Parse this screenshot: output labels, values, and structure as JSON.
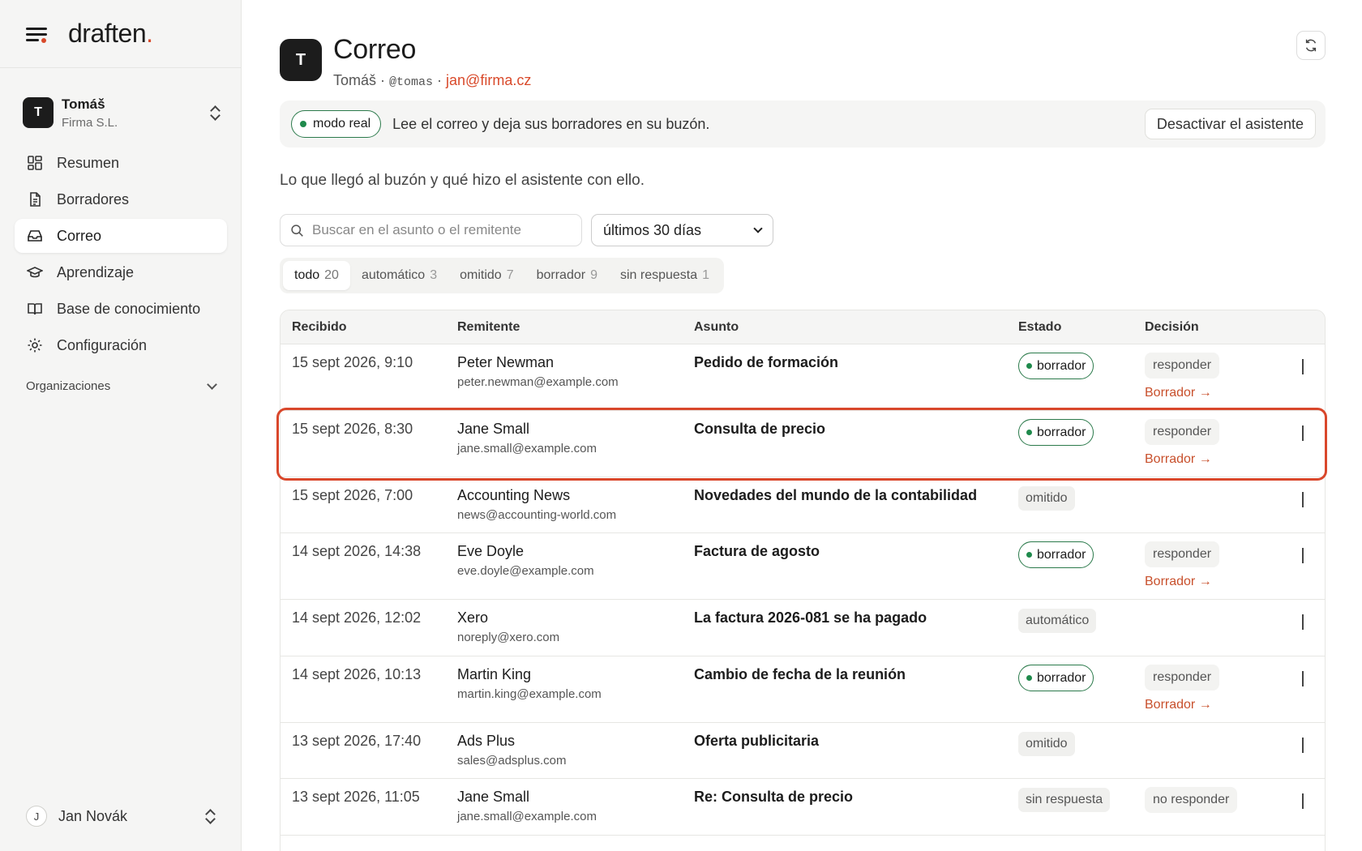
{
  "brand": {
    "name": "draften",
    "dot": "."
  },
  "org": {
    "initial": "T",
    "name": "Tomáš",
    "company": "Firma S.L."
  },
  "nav": {
    "items": [
      {
        "label": "Resumen",
        "icon": "dashboard-icon"
      },
      {
        "label": "Borradores",
        "icon": "document-icon"
      },
      {
        "label": "Correo",
        "icon": "inbox-icon",
        "active": true
      },
      {
        "label": "Aprendizaje",
        "icon": "graduation-cap-icon"
      },
      {
        "label": "Base de conocimiento",
        "icon": "book-icon"
      },
      {
        "label": "Configuración",
        "icon": "gear-icon"
      }
    ],
    "section_label": "Organizaciones"
  },
  "user": {
    "initial": "J",
    "name": "Jan Novák"
  },
  "header": {
    "initial": "T",
    "title": "Correo",
    "owner": "Tomáš",
    "sep1": " · ",
    "handle": "@tomas",
    "sep2": " · ",
    "email": "jan@firma.cz"
  },
  "banner": {
    "mode": "modo real",
    "text": "Lee el correo y deja sus borradores en su buzón.",
    "button": "Desactivar el asistente"
  },
  "intro": "Lo que llegó al buzón y qué hizo el asistente con ello.",
  "search": {
    "placeholder": "Buscar en el asunto o el remitente"
  },
  "period": {
    "selected": "últimos 30 días"
  },
  "filters": [
    {
      "label": "todo",
      "count": "20",
      "active": true
    },
    {
      "label": "automático",
      "count": "3"
    },
    {
      "label": "omitido",
      "count": "7"
    },
    {
      "label": "borrador",
      "count": "9"
    },
    {
      "label": "sin respuesta",
      "count": "1"
    }
  ],
  "table": {
    "headers": {
      "received": "Recibido",
      "sender": "Remitente",
      "subject": "Asunto",
      "status": "Estado",
      "decision": "Decisión"
    },
    "rows": [
      {
        "received": "15 sept 2026, 9:10",
        "sender": "Peter Newman",
        "email": "peter.newman@example.com",
        "subject": "Pedido de formación",
        "status": "borrador",
        "decision": "responder",
        "link": "Borrador →"
      },
      {
        "received": "15 sept 2026, 8:30",
        "sender": "Jane Small",
        "email": "jane.small@example.com",
        "subject": "Consulta de precio",
        "status": "borrador",
        "decision": "responder",
        "link": "Borrador →"
      },
      {
        "received": "15 sept 2026, 7:00",
        "sender": "Accounting News",
        "email": "news@accounting-world.com",
        "subject": "Novedades del mundo de la contabilidad",
        "status": "omitido",
        "decision": "",
        "link": ""
      },
      {
        "received": "14 sept 2026, 14:38",
        "sender": "Eve Doyle",
        "email": "eve.doyle@example.com",
        "subject": "Factura de agosto",
        "status": "borrador",
        "decision": "responder",
        "link": "Borrador →"
      },
      {
        "received": "14 sept 2026, 12:02",
        "sender": "Xero",
        "email": "noreply@xero.com",
        "subject": "La factura 2026-081 se ha pagado",
        "status": "automático",
        "decision": "",
        "link": ""
      },
      {
        "received": "14 sept 2026, 10:13",
        "sender": "Martin King",
        "email": "martin.king@example.com",
        "subject": "Cambio de fecha de la reunión",
        "status": "borrador",
        "decision": "responder",
        "link": "Borrador →"
      },
      {
        "received": "13 sept 2026, 17:40",
        "sender": "Ads Plus",
        "email": "sales@adsplus.com",
        "subject": "Oferta publicitaria",
        "status": "omitido",
        "decision": "",
        "link": ""
      },
      {
        "received": "13 sept 2026, 11:05",
        "sender": "Jane Small",
        "email": "jane.small@example.com",
        "subject": "Re: Consulta de precio",
        "status": "sin respuesta",
        "decision": "no responder",
        "link": ""
      }
    ]
  },
  "colors": {
    "accent": "#d94a2b",
    "green": "#1f8a4c",
    "highlight": "#d9472b"
  }
}
